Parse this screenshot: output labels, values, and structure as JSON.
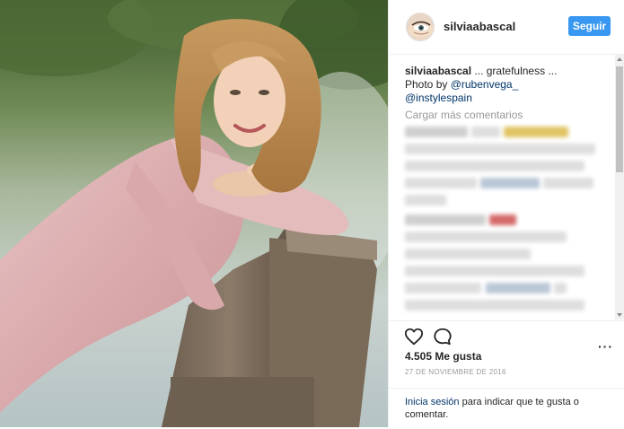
{
  "post": {
    "photo_alt": "Woman in pink satin dress leaning on a wooden bench by a lake"
  },
  "header": {
    "username": "silviaabascal",
    "follow_label": "Seguir"
  },
  "caption": {
    "username": "silviaabascal",
    "text": " ... gratefulness ...",
    "credit_prefix": "Photo by ",
    "credit_handle": "@rubenvega_",
    "tag": "@instylespain"
  },
  "comments": {
    "load_more": "Cargar más comentarios"
  },
  "actions": {
    "like_icon": "heart-icon",
    "comment_icon": "comment-icon",
    "likes": "4.505 Me gusta",
    "date": "27 DE NOVIEMBRE DE 2016",
    "more_label": "···"
  },
  "login": {
    "link_text": "Inicia sesión",
    "rest_text": " para indicar que te gusta o comentar."
  },
  "colors": {
    "accent": "#3897f0",
    "link": "#003569",
    "muted": "#999999"
  }
}
